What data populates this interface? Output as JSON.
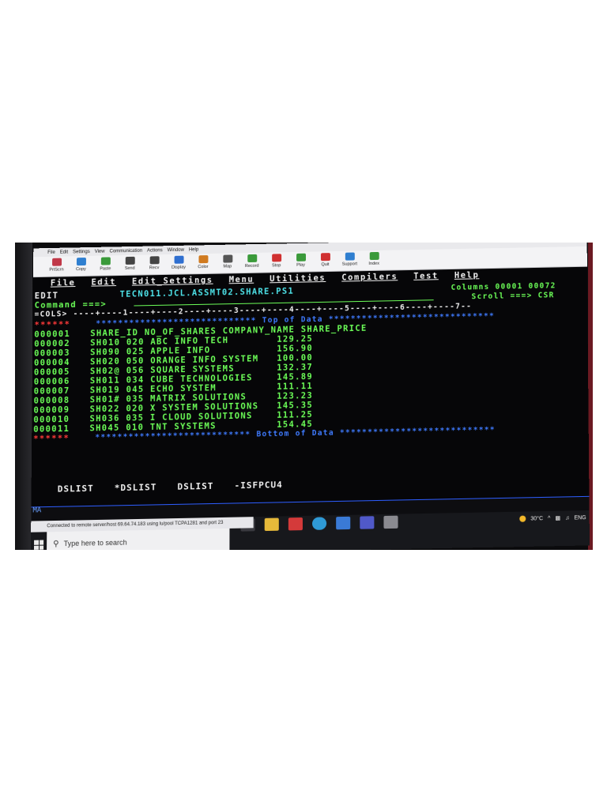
{
  "emulator": {
    "menu": [
      "File",
      "Edit",
      "Settings",
      "View",
      "Communication",
      "Actions",
      "Window",
      "Help"
    ],
    "toolbar": [
      {
        "label": "PrtScrn",
        "icon": "print-screen-icon",
        "color": "#c03848"
      },
      {
        "label": "Copy",
        "icon": "copy-icon",
        "color": "#2f7fd0"
      },
      {
        "label": "Paste",
        "icon": "paste-icon",
        "color": "#3a9a3a"
      },
      {
        "label": "Send",
        "icon": "send-icon",
        "color": "#444"
      },
      {
        "label": "Recv",
        "icon": "receive-icon",
        "color": "#444"
      },
      {
        "label": "Display",
        "icon": "display-icon",
        "color": "#2f6fd0"
      },
      {
        "label": "Color",
        "icon": "color-palette-icon",
        "color": "#d07a20"
      },
      {
        "label": "Map",
        "icon": "keyboard-map-icon",
        "color": "#555"
      },
      {
        "label": "Record",
        "icon": "record-icon",
        "color": "#3a9a3a"
      },
      {
        "label": "Stop",
        "icon": "stop-icon",
        "color": "#d03030"
      },
      {
        "label": "Play",
        "icon": "play-icon",
        "color": "#3a9a3a"
      },
      {
        "label": "Quit",
        "icon": "quit-icon",
        "color": "#d03030"
      },
      {
        "label": "Support",
        "icon": "globe-icon",
        "color": "#2f7fd0"
      },
      {
        "label": "Index",
        "icon": "help-icon",
        "color": "#3a9a3a"
      }
    ]
  },
  "ispf": {
    "menu_bar": [
      "File",
      "Edit",
      "Edit_Settings",
      "Menu",
      "Utilities",
      "Compilers",
      "Test",
      "Help"
    ],
    "mode": "EDIT",
    "dataset": "TECN011.JCL.ASSMT02.SHARE.PS1",
    "columns_label": "Columns 00001 00072",
    "command_prompt": "Command ===>",
    "scroll_label": "Scroll ===> CSR",
    "cols_row": "=COLS> ----+----1----+----2----+----3----+----4----+----5----+----6----+----7--",
    "top_marker": "******",
    "top_of_data": "***************************** Top of Data ******************************",
    "bottom_marker": "******",
    "bottom_of_data": "**************************** Bottom of Data ****************************",
    "header_line": {
      "line": "000001",
      "text": "SHARE_ID NO_OF_SHARES COMPANY_NAME SHARE_PRICE"
    },
    "records": [
      {
        "line": "000002",
        "text": "SH010 020 ABC INFO TECH        129.25"
      },
      {
        "line": "000003",
        "text": "SH090 025 APPLE INFO           156.90"
      },
      {
        "line": "000004",
        "text": "SH020 050 ORANGE INFO SYSTEM   100.00"
      },
      {
        "line": "000005",
        "text": "SH02@ 056 SQUARE SYSTEMS       132.37"
      },
      {
        "line": "000006",
        "text": "SH011 034 CUBE TECHNOLOGIES    145.89"
      },
      {
        "line": "000007",
        "text": "SH019 045 ECHO SYSTEM          111.11"
      },
      {
        "line": "000008",
        "text": "SH01# 035 MATRIX SOLUTIONS     123.23"
      },
      {
        "line": "000009",
        "text": "SH022 020 X SYSTEM SOLUTIONS   145.35"
      },
      {
        "line": "000010",
        "text": "SH036 035 I CLOUD SOLUTIONS    111.25"
      },
      {
        "line": "000011",
        "text": "SH045 010 TNT SYSTEMS          154.45"
      }
    ],
    "fn_keys": [
      "DSLIST",
      "*DSLIST",
      "DSLIST",
      "-ISFPCU4"
    ],
    "oia": "MA"
  },
  "windows": {
    "connection": "Connected to remote server/host 69.64.74.183 using lu/pool TCPA1281 and port 23",
    "search_placeholder": "Type here to search",
    "weather": "30°C",
    "lang": "ENG"
  }
}
